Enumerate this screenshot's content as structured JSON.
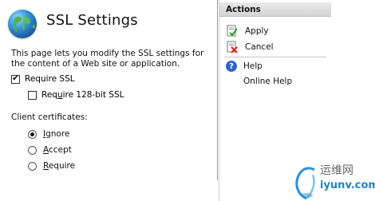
{
  "page": {
    "title": "SSL Settings",
    "description": "This page lets you modify the SSL settings for the content of a Web site or application.",
    "require_ssl": {
      "label_pre": "Require ",
      "label_rest": "SSL",
      "checked": true
    },
    "require_128": {
      "label_pre": "Req",
      "label_u": "u",
      "label_rest": "ire 128-bit SSL",
      "checked": false
    },
    "client_certs_label": "Client certificates:",
    "radios": [
      {
        "label_u": "I",
        "label_rest": "gnore",
        "selected": true
      },
      {
        "label_u": "A",
        "label_rest": "ccept",
        "selected": false
      },
      {
        "label_u": "R",
        "label_rest": "equire",
        "selected": false
      }
    ]
  },
  "actions": {
    "header": "Actions",
    "apply": "Apply",
    "cancel": "Cancel",
    "help": "Help",
    "online_help": "Online Help"
  },
  "watermark": {
    "cn": "运维网",
    "url": "iyunv.com"
  }
}
